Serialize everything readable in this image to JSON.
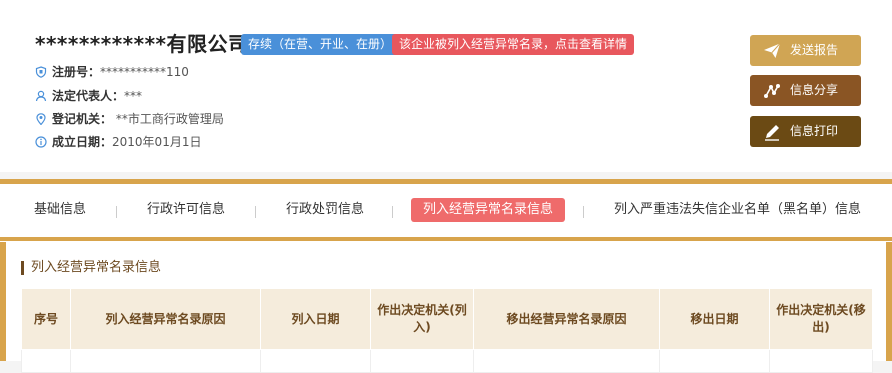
{
  "company": {
    "name": "************有限公司",
    "status_tag": "存续（在营、开业、在册）",
    "warning_tag": "该企业被列入经营异常名录，点击查看详情",
    "fields": [
      {
        "label": "注册号：",
        "value": "***********110",
        "icon": "shield-icon"
      },
      {
        "label": "法定代表人：",
        "value": "***",
        "icon": "person-icon"
      },
      {
        "label": "登记机关：",
        "value": "**市工商行政管理局",
        "icon": "location-icon"
      },
      {
        "label": "成立日期：",
        "value": "2010年01月1日",
        "icon": "info-icon"
      }
    ]
  },
  "actions": [
    {
      "label": "发送报告",
      "icon": "send-icon",
      "color": "#d0a554"
    },
    {
      "label": "信息分享",
      "icon": "share-icon",
      "color": "#8a5524"
    },
    {
      "label": "信息打印",
      "icon": "print-icon",
      "color": "#6b4a14"
    }
  ],
  "tabs": [
    {
      "label": "基础信息"
    },
    {
      "label": "行政许可信息"
    },
    {
      "label": "行政处罚信息"
    },
    {
      "label": "列入经营异常名录信息",
      "active": true
    },
    {
      "label": "列入严重违法失信企业名单（黑名单）信息"
    }
  ],
  "section": {
    "title": "列入经营异常名录信息",
    "columns": [
      "序号",
      "列入经营异常名录原因",
      "列入日期",
      "作出决定机关(列入)",
      "移出经营异常名录原因",
      "移出日期",
      "作出决定机关(移出)"
    ]
  },
  "colors": {
    "gold": "#d8a44c",
    "brown": "#6d4a21",
    "active_tab": "#ef6b6b",
    "status_tag": "#4a90d9",
    "warning_tag": "#e8575d"
  }
}
